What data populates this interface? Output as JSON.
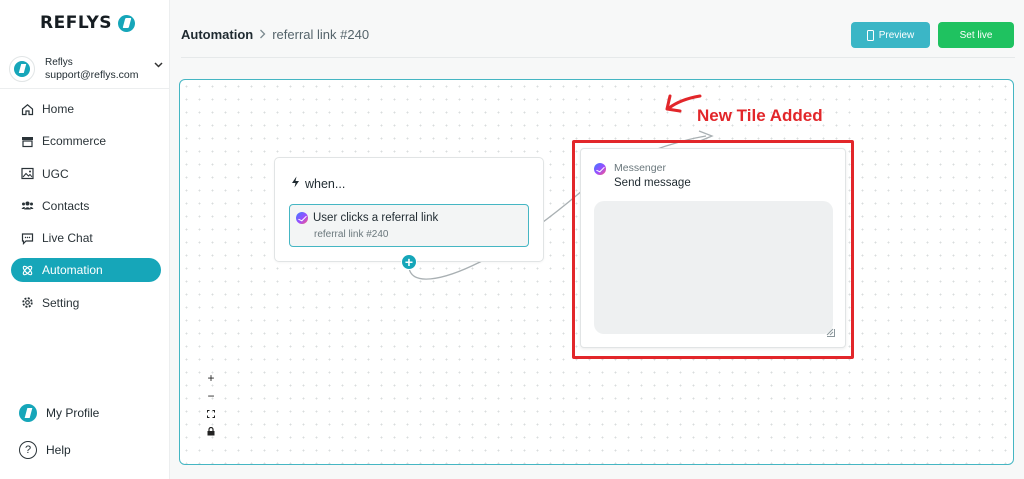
{
  "brand": {
    "name": "REFLYS",
    "accent": "#16a6b9"
  },
  "account": {
    "name": "Reflys",
    "email": "support@reflys.com"
  },
  "sidebar": {
    "items": [
      {
        "label": "Home",
        "icon": "home-icon"
      },
      {
        "label": "Ecommerce",
        "icon": "store-icon"
      },
      {
        "label": "UGC",
        "icon": "image-icon"
      },
      {
        "label": "Contacts",
        "icon": "users-icon"
      },
      {
        "label": "Live Chat",
        "icon": "chat-icon"
      },
      {
        "label": "Automation",
        "icon": "automation-icon",
        "active": true
      },
      {
        "label": "Setting",
        "icon": "gear-icon"
      }
    ],
    "profile_label": "My Profile",
    "help_label": "Help",
    "help_glyph": "?"
  },
  "header": {
    "breadcrumb_root": "Automation",
    "breadcrumb_sep": ">",
    "breadcrumb_current": "referral link #240",
    "preview_label": "Preview",
    "set_live_label": "Set live",
    "colors": {
      "preview": "#3bb6c6",
      "set_live": "#1fc260"
    }
  },
  "flow": {
    "trigger_card": {
      "title": "when...",
      "trigger_title": "User clicks a referral link",
      "trigger_subtitle": "referral link #240"
    },
    "add_node_glyph": "+",
    "message_card": {
      "channel": "Messenger",
      "action": "Send message",
      "message_value": ""
    },
    "annotation": {
      "text": "New Tile Added",
      "color": "#e2262a"
    }
  },
  "zoom_controls": [
    "+",
    "−",
    "⛶",
    "🔒"
  ]
}
